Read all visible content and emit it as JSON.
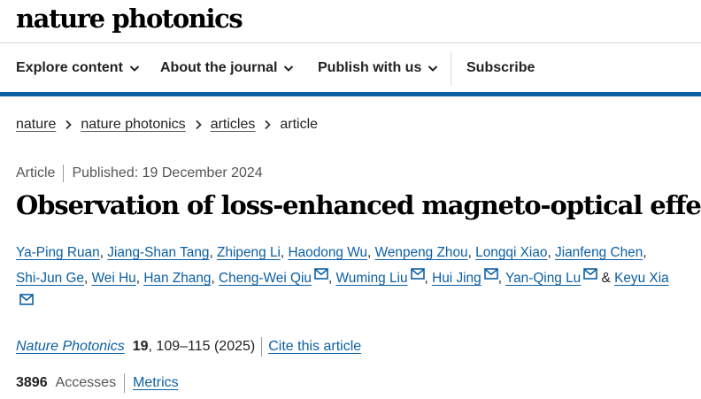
{
  "masthead": {
    "logo": "nature photonics"
  },
  "nav": {
    "items": [
      {
        "label": "Explore content"
      },
      {
        "label": "About the journal"
      },
      {
        "label": "Publish with us"
      }
    ],
    "subscribe": "Subscribe"
  },
  "breadcrumb": {
    "items": [
      "nature",
      "nature photonics",
      "articles"
    ],
    "current": "article"
  },
  "article": {
    "type": "Article",
    "published": "Published: 19 December 2024",
    "title": "Observation of loss-enhanced magneto-optical effect",
    "authors": [
      "Ya-Ping Ruan",
      "Jiang-Shan Tang",
      "Zhipeng Li",
      "Haodong Wu",
      "Wenpeng Zhou",
      "Longqi Xiao",
      "Jianfeng Chen",
      "Shi-Jun Ge",
      "Wei Hu",
      "Han Zhang",
      "Cheng-Wei Qiu",
      "Wuming Liu",
      "Hui Jing",
      "Yan-Qing Lu",
      "Keyu Xia"
    ],
    "and_symbol": "&",
    "journal": "Nature Photonics",
    "volume": "19",
    "pages_year": ", 109–115 (2025)",
    "cite_link": "Cite this article",
    "accesses_count": "3896",
    "accesses_label": "Accesses",
    "metrics_link": "Metrics"
  },
  "colors": {
    "link": "#0c5fa3",
    "nav_rule": "#0c5fa3",
    "text": "#222222"
  }
}
